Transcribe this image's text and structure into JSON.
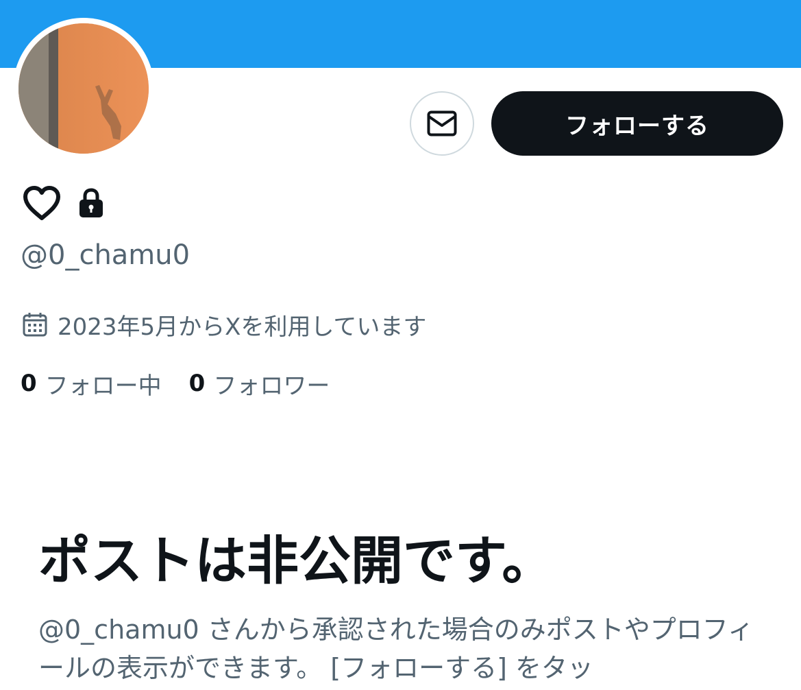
{
  "colors": {
    "banner": "#1d9bf0",
    "primary_text": "#0f1419",
    "secondary_text": "#536471",
    "border": "#cfd9de",
    "follow_button_bg": "#0f1419"
  },
  "profile": {
    "avatar_icon": "profile-photo",
    "name_icons": [
      "heart-outline-icon",
      "lock-icon"
    ],
    "handle": "@0_chamu0",
    "joined": "2023年5月からXを利用しています",
    "following_count": "0",
    "following_label": "フォロー中",
    "followers_count": "0",
    "followers_label": "フォロワー"
  },
  "actions": {
    "message_icon": "envelope-icon",
    "follow_label": "フォローする"
  },
  "private_notice": {
    "heading": "ポストは非公開です。",
    "body": "@0_chamu0 さんから承認された場合のみポストやプロフィールの表示ができます。 [フォローする] をタッ"
  }
}
